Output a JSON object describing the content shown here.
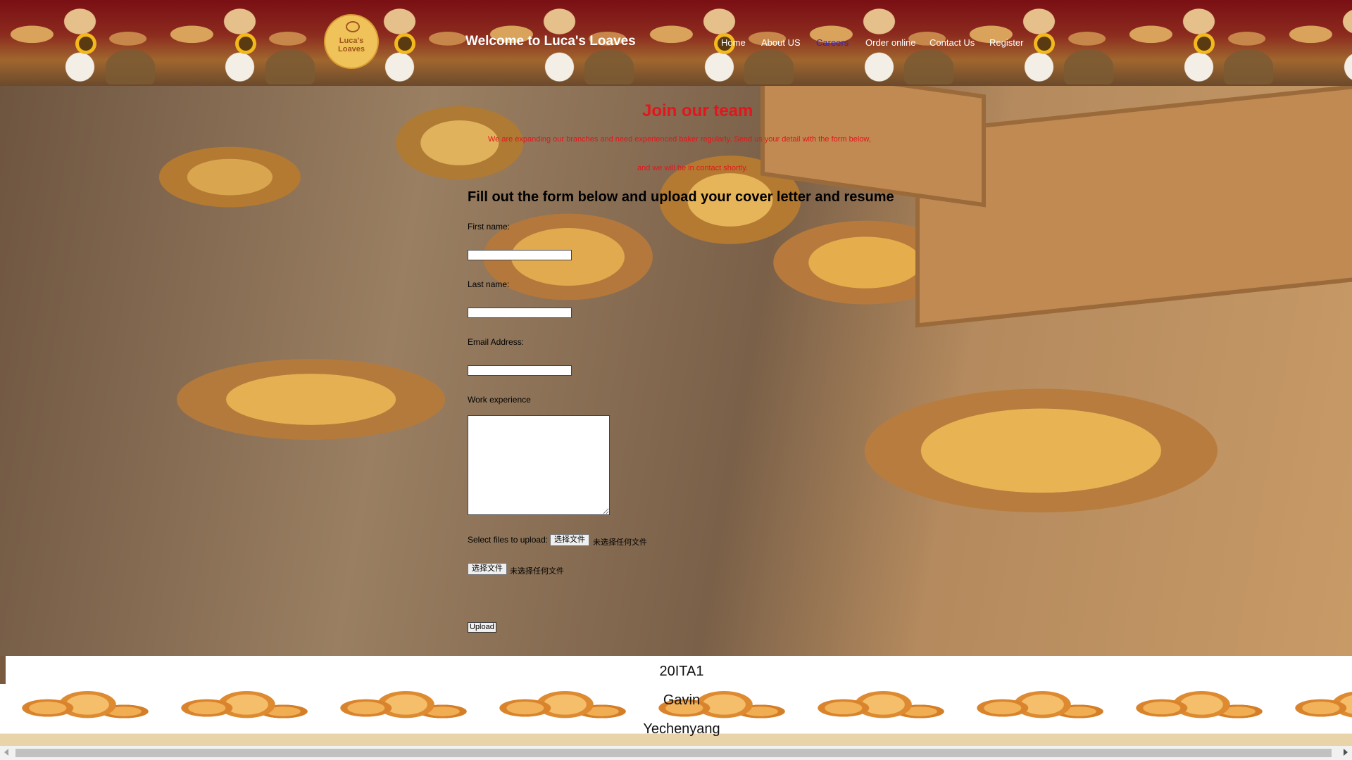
{
  "header": {
    "logo_text": "Luca's Loaves",
    "site_title": "Welcome to Luca's Loaves",
    "nav": [
      {
        "label": "Home"
      },
      {
        "label": "About US"
      },
      {
        "label": "Careers",
        "active": true
      },
      {
        "label": "Order online"
      },
      {
        "label": "Contact Us"
      },
      {
        "label": "Register"
      }
    ],
    "active_color": "#2c1dd1"
  },
  "main": {
    "title": "Join our team",
    "intro_line_1": "We are expanding our branches and need experienced baker regularly. Send us your detail with the form below,",
    "intro_line_2": "and we will be in contact shortly.",
    "accent_color": "#e4151c",
    "form": {
      "heading": "Fill out the form below and upload your cover letter and resume",
      "first_name_label": "First name:",
      "first_name_value": "",
      "last_name_label": "Last name:",
      "last_name_value": "",
      "email_label": "Email Address:",
      "email_value": "",
      "work_label": "Work experience",
      "work_value": "",
      "select_files_label": "Select files to upload:",
      "file_button_label": "选择文件",
      "file_status": "未选择任何文件",
      "upload_label": "Upload"
    }
  },
  "footer": {
    "line_1": "20ITA1",
    "line_2": "Gavin",
    "line_3": "Yechenyang"
  }
}
